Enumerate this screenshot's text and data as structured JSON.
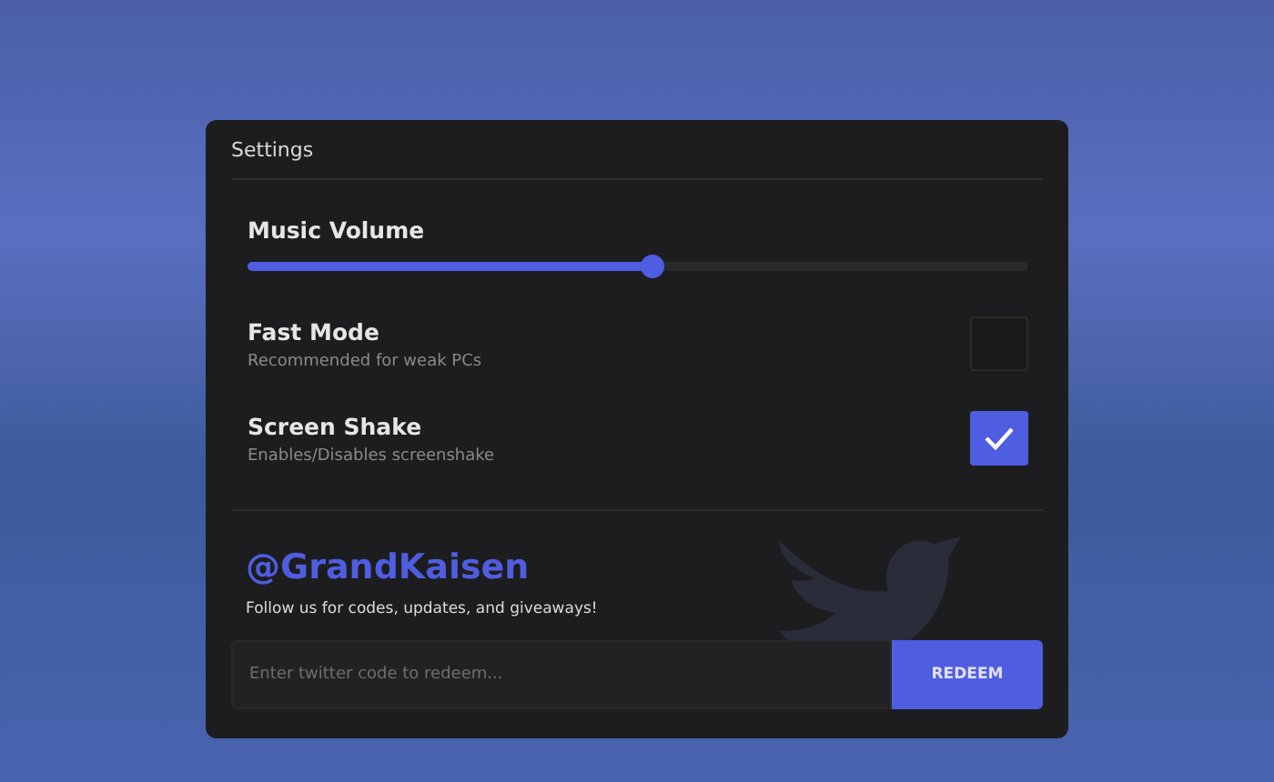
{
  "panel": {
    "title": "Settings",
    "settings": [
      {
        "kind": "slider",
        "label": "Music Volume",
        "level": 0.52
      },
      {
        "kind": "checkbox",
        "label": "Fast Mode",
        "description": "Recommended for weak PCs",
        "checked": false
      },
      {
        "kind": "checkbox",
        "label": "Screen Shake",
        "description": "Enables/Disables screenshake",
        "checked": true
      }
    ],
    "social": {
      "handle": "@GrandKaisen",
      "tagline": "Follow us for codes, updates, and giveaways!"
    },
    "redeem": {
      "placeholder": "Enter twitter code to redeem...",
      "button": "REDEEM"
    }
  }
}
